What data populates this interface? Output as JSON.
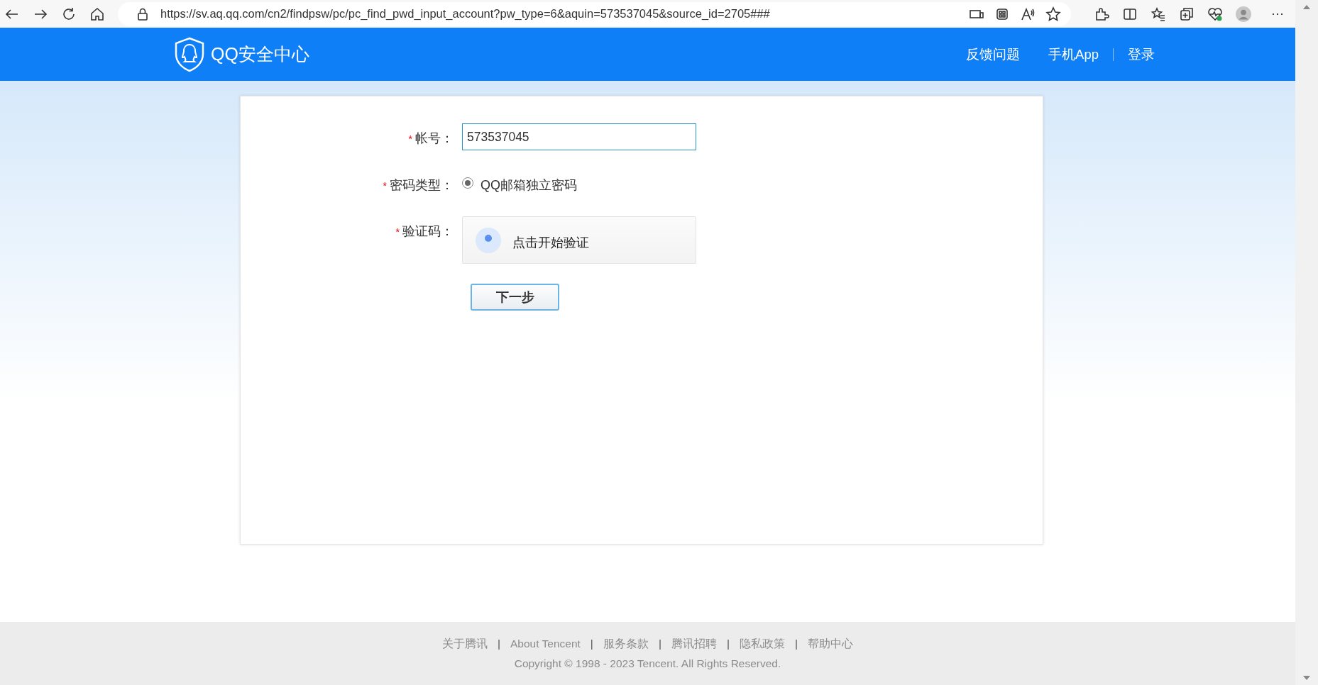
{
  "browser": {
    "url": "https://sv.aq.qq.com/cn2/findpsw/pc/pc_find_pwd_input_account?pw_type=6&aquin=573537045&source_id=2705###",
    "more": "···"
  },
  "header": {
    "logo": "QQ安全中心",
    "nav": [
      {
        "label": "反馈问题",
        "divider_before": false
      },
      {
        "label": "手机App",
        "divider_before": false
      },
      {
        "label": "登录",
        "divider_before": true
      }
    ]
  },
  "form": {
    "fields": [
      {
        "kind": "text",
        "mark": "*",
        "label": "帐号：",
        "value": "573537045"
      },
      {
        "kind": "radio",
        "mark": "*",
        "label": "密码类型：",
        "option": "QQ邮箱独立密码",
        "checked": true
      },
      {
        "kind": "captcha",
        "mark": "*",
        "label": "验证码：",
        "prompt": "点击开始验证"
      }
    ],
    "submit": "下一步"
  },
  "footer": {
    "items": [
      {
        "kind": "link",
        "text": "关于腾讯"
      },
      {
        "kind": "separator",
        "text": "|"
      },
      {
        "kind": "link",
        "text": "About Tencent"
      },
      {
        "kind": "separator",
        "text": "|"
      },
      {
        "kind": "link",
        "text": "服务条款"
      },
      {
        "kind": "separator",
        "text": "|"
      },
      {
        "kind": "link",
        "text": "腾讯招聘"
      },
      {
        "kind": "separator",
        "text": "|"
      },
      {
        "kind": "link",
        "text": "隐私政策"
      },
      {
        "kind": "separator",
        "text": "|"
      },
      {
        "kind": "link",
        "text": "帮助中心"
      }
    ],
    "copyright": "Copyright © 1998 - 2023 Tencent. All Rights Reserved."
  }
}
